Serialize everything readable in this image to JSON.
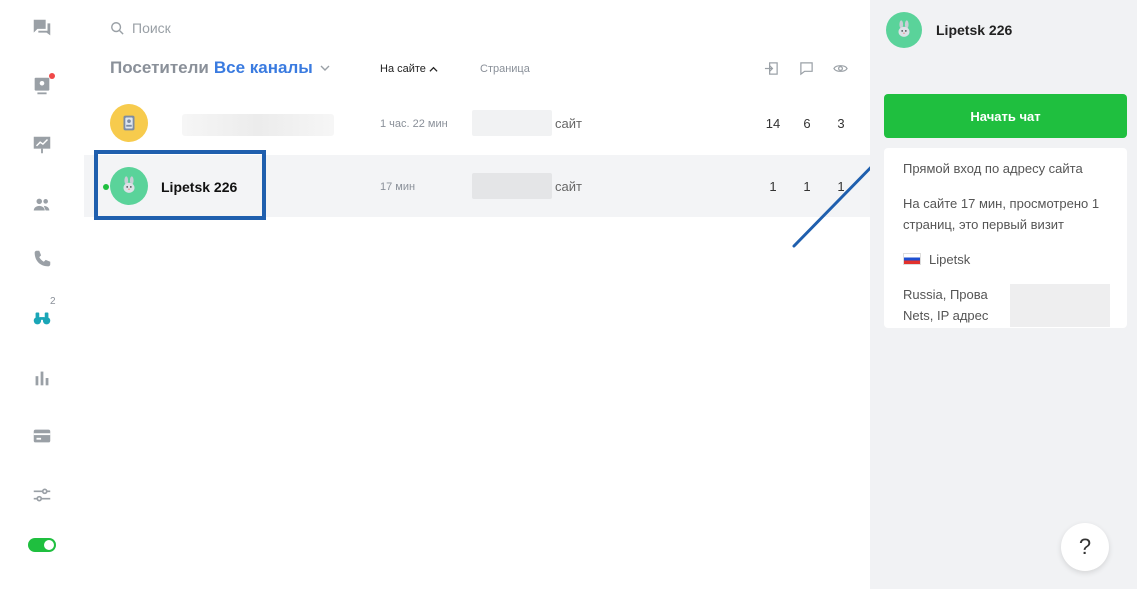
{
  "search": {
    "placeholder": "Поиск"
  },
  "heading": {
    "label": "Посетители",
    "channel": "Все каналы"
  },
  "columns": {
    "on_site": "На сайте",
    "page": "Страница"
  },
  "nav": {
    "live_badge": "2"
  },
  "visitors": [
    {
      "name": "",
      "time": "1 час. 22 мин",
      "page": "сайт",
      "entries": "14",
      "chats": "6",
      "views": "3"
    },
    {
      "name": "Lipetsk 226",
      "time": "17 мин",
      "page": "сайт",
      "entries": "1",
      "chats": "1",
      "views": "1"
    }
  ],
  "panel": {
    "name": "Lipetsk 226",
    "start_chat": "Начать чат",
    "source": "Прямой вход по адресу сайта",
    "visit_info": "На сайте 17 мин, просмотрено 1 страниц, это первый визит",
    "city": "Lipetsk",
    "country_line": "Russia, Прова",
    "provider_line": "Nets, IP адрес"
  },
  "help": {
    "label": "?"
  },
  "colors": {
    "accent_green": "#1fbf3f",
    "link_blue": "#3a7be0",
    "highlight_blue": "#1f5fae"
  }
}
